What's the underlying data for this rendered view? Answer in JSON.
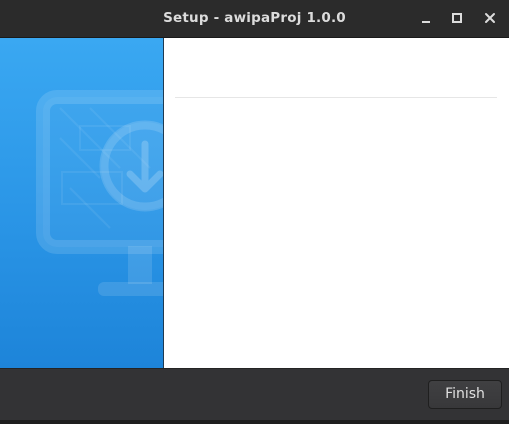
{
  "window": {
    "title": "Setup - awipaProj 1.0.0"
  },
  "titlebar_buttons": {
    "minimize_icon": "minimize-icon",
    "maximize_icon": "maximize-icon",
    "close_icon": "close-icon"
  },
  "sidebar": {
    "artwork_icon": "monitor-download-icon"
  },
  "footer": {
    "finish_label": "Finish"
  },
  "colors": {
    "sidebar_top": "#3aa8f2",
    "sidebar_bottom": "#1d84d9",
    "titlebar": "#2b2b2b",
    "footer": "#333335",
    "content": "#ffffff"
  }
}
